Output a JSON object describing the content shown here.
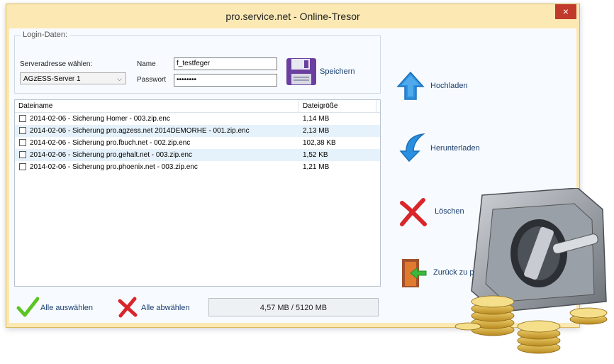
{
  "window": {
    "title": "pro.service.net - Online-Tresor",
    "close_glyph": "×"
  },
  "login": {
    "legend": "Login-Daten:",
    "server_label": "Serveradresse wählen:",
    "server_value": "AGzESS-Server 1",
    "name_label": "Name",
    "name_value": "f_testfeger",
    "password_label": "Passwort",
    "password_value": "••••••••",
    "save_label": "Speichern"
  },
  "files": {
    "headers": {
      "name": "Dateiname",
      "size": "Dateigröße"
    },
    "rows": [
      {
        "name": "2014-02-06 - Sicherung Homer - 003.zip.enc",
        "size": "1,14 MB"
      },
      {
        "name": "2014-02-06 - Sicherung pro.agzess.net 2014DEMORHE - 001.zip.enc",
        "size": "2,13 MB"
      },
      {
        "name": "2014-02-06 - Sicherung pro.fbuch.net - 002.zip.enc",
        "size": "102,38 KB"
      },
      {
        "name": "2014-02-06 - Sicherung pro.gehalt.net - 003.zip.enc",
        "size": "1,52 KB"
      },
      {
        "name": "2014-02-06 - Sicherung pro.phoenix.net - 003.zip.enc",
        "size": "1,21 MB"
      }
    ]
  },
  "actions": {
    "upload": "Hochladen",
    "download": "Herunterladen",
    "delete": "Löschen",
    "back": "Zurück zu p"
  },
  "bottom": {
    "select_all": "Alle auswählen",
    "deselect_all": "Alle abwählen",
    "usage": "4,57 MB / 5120 MB"
  },
  "colors": {
    "window": "#fbe8b3",
    "close": "#c0392b",
    "accent_blue": "#2b8fe0",
    "red_x": "#d9262a",
    "check_green": "#5cc424"
  }
}
